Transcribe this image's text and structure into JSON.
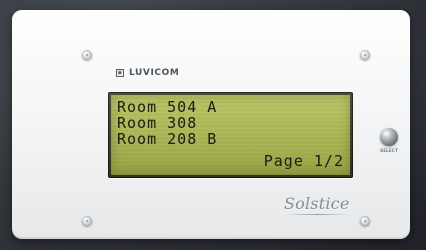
{
  "brand": {
    "name": "LUVICOM",
    "mark": "▣"
  },
  "display": {
    "rows": [
      "Room 504 A",
      "Room 308",
      "Room 208 B"
    ],
    "page_indicator": "Page 1/2",
    "lcd_color": "#aeb955",
    "text_color": "#1d2118"
  },
  "controls": {
    "side_button_label": "SELECT"
  },
  "product": {
    "logo": "Solstice"
  },
  "colors": {
    "panel": "#f3f4f5",
    "background": "#2f333a",
    "accent": "#858b92"
  }
}
